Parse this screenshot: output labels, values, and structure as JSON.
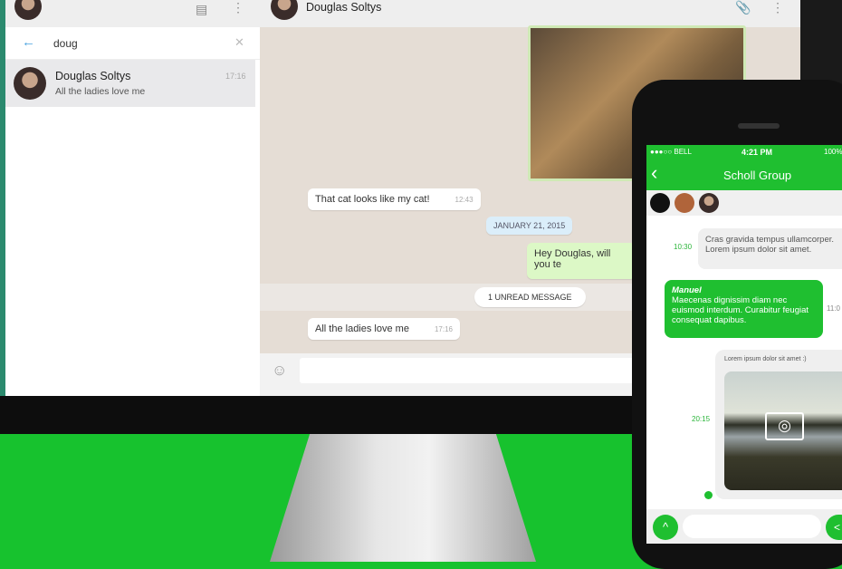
{
  "sidebar": {
    "search_value": "doug",
    "result": {
      "name": "Douglas Soltys",
      "preview": "All the ladies love me",
      "time": "17:16"
    }
  },
  "chat": {
    "contact": "Douglas Soltys",
    "messages": [
      {
        "text": "That cat looks like my cat!",
        "time": "12:43"
      },
      {
        "date": "JANUARY 21, 2015"
      },
      {
        "text": "Hey Douglas, will you te"
      },
      {
        "unread": "1 UNREAD MESSAGE"
      },
      {
        "text": "All the ladies love me",
        "time": "17:16"
      }
    ]
  },
  "phone": {
    "carrier": "●●●○○ BELL",
    "clock": "4:21 PM",
    "battery": "100%",
    "title": "Scholl Group",
    "messages": [
      {
        "time": "10:30",
        "text": "Cras gravida tempus ullamcorper. Lorem ipsum dolor sit amet."
      },
      {
        "sender": "Manuel",
        "text": "Maecenas dignissim diam nec euismod interdum. Curabitur feugiat consequat dapibus.",
        "time": "11:0"
      },
      {
        "caption": "Lorem ipsum dolor sit amet :)",
        "time": "20:15"
      }
    ]
  },
  "colors": {
    "brand_green": "#1fbf30",
    "chat_bg": "#e5ddd5",
    "outgoing": "#dcf8c6"
  }
}
